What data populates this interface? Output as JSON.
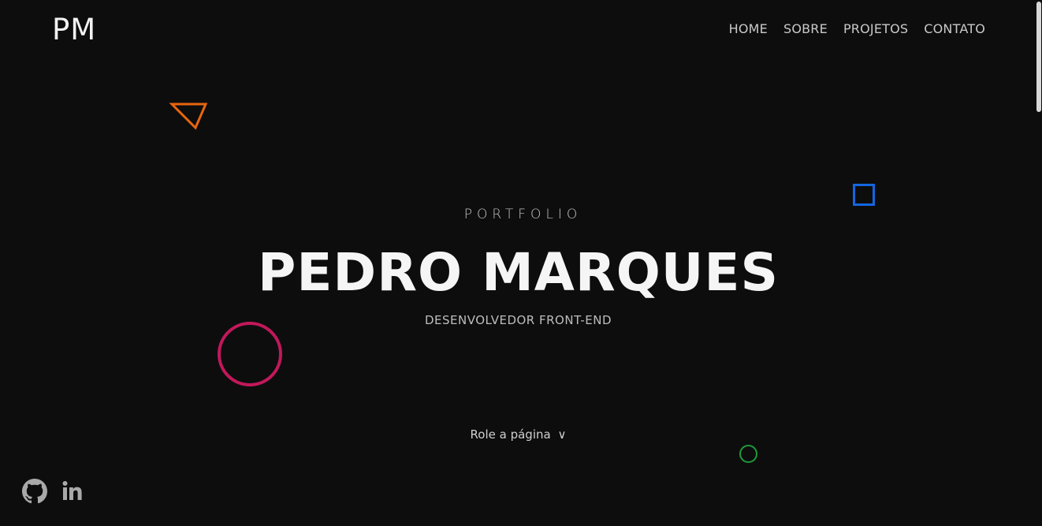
{
  "logo": "PM",
  "nav": {
    "home": "HOME",
    "sobre": "SOBRE",
    "projetos": "PROJETOS",
    "contato": "CONTATO"
  },
  "hero": {
    "eyebrow": "PORTFOLIO",
    "name": "PEDRO MARQUES",
    "role": "DESENVOLVEDOR FRONT-END",
    "scroll_hint": "Role a página",
    "scroll_chevron": "∨"
  },
  "social": {
    "github_icon": "github-icon",
    "linkedin_icon": "linkedin-icon"
  },
  "colors": {
    "background": "#0d0d0d",
    "triangle": "#e8650f",
    "square": "#1466e0",
    "big_circle": "#c2185b",
    "small_circle": "#1f9a3a",
    "social_icons": "#a9a9a9"
  }
}
